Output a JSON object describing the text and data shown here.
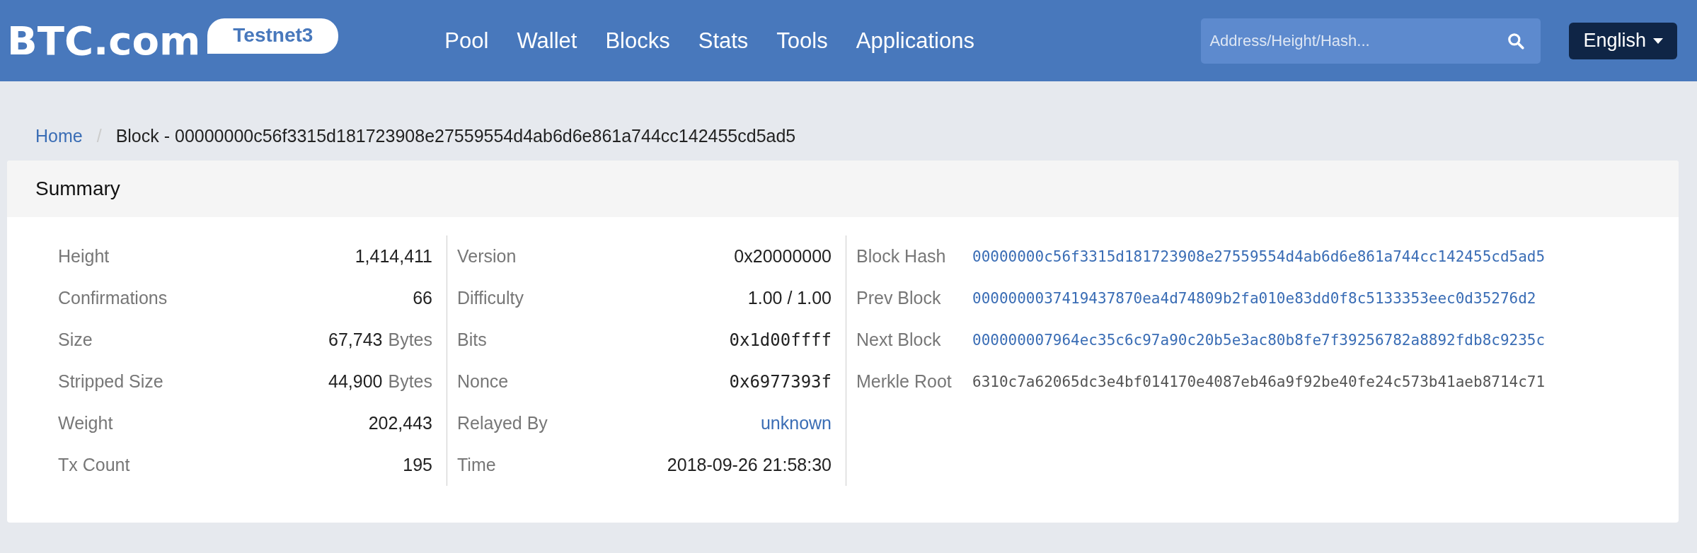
{
  "header": {
    "logo": "BTC.com",
    "network_badge": "Testnet3",
    "nav": [
      "Pool",
      "Wallet",
      "Blocks",
      "Stats",
      "Tools",
      "Applications"
    ],
    "search": {
      "placeholder": "Address/Height/Hash..."
    },
    "language": "English"
  },
  "breadcrumb": [
    {
      "label": "Home",
      "kind": "link"
    },
    {
      "label": "/",
      "kind": "separator"
    },
    {
      "label": "Block - 00000000c56f3315d181723908e27559554d4ab6d6e861a744cc142455cd5ad5",
      "kind": "current"
    }
  ],
  "summary": {
    "title": "Summary",
    "columns": [
      {
        "rows": [
          {
            "label": "Height",
            "value": "1,414,411",
            "kind": "text"
          },
          {
            "label": "Confirmations",
            "value": "66",
            "kind": "text"
          },
          {
            "label": "Size",
            "value": "67,743",
            "unit": "Bytes",
            "kind": "text"
          },
          {
            "label": "Stripped Size",
            "value": "44,900",
            "unit": "Bytes",
            "kind": "text"
          },
          {
            "label": "Weight",
            "value": "202,443",
            "kind": "text"
          },
          {
            "label": "Tx Count",
            "value": "195",
            "kind": "text"
          }
        ]
      },
      {
        "rows": [
          {
            "label": "Version",
            "value": "0x20000000",
            "kind": "text"
          },
          {
            "label": "Difficulty",
            "value": "1.00 / 1.00",
            "kind": "text"
          },
          {
            "label": "Bits",
            "value": "0x1d00ffff",
            "kind": "mono"
          },
          {
            "label": "Nonce",
            "value": "0x6977393f",
            "kind": "mono"
          },
          {
            "label": "Relayed By",
            "value": "unknown",
            "kind": "link"
          },
          {
            "label": "Time",
            "value": "2018-09-26 21:58:30",
            "kind": "text"
          }
        ]
      },
      {
        "rows": [
          {
            "label": "Block Hash",
            "value": "00000000c56f3315d181723908e27559554d4ab6d6e861a744cc142455cd5ad5",
            "kind": "mono-link"
          },
          {
            "label": "Prev Block",
            "value": "0000000037419437870ea4d74809b2fa010e83dd0f8c5133353eec0d35276d2",
            "kind": "mono-link"
          },
          {
            "label": "Next Block",
            "value": "000000007964ec35c6c97a90c20b5e3ac80b8fe7f39256782a8892fdb8c9235c",
            "kind": "mono-link"
          },
          {
            "label": "Merkle Root",
            "value": "6310c7a62065dc3e4bf014170e4087eb46a9f92be40fe24c573b41aeb8714c71",
            "kind": "mono"
          }
        ]
      }
    ]
  }
}
